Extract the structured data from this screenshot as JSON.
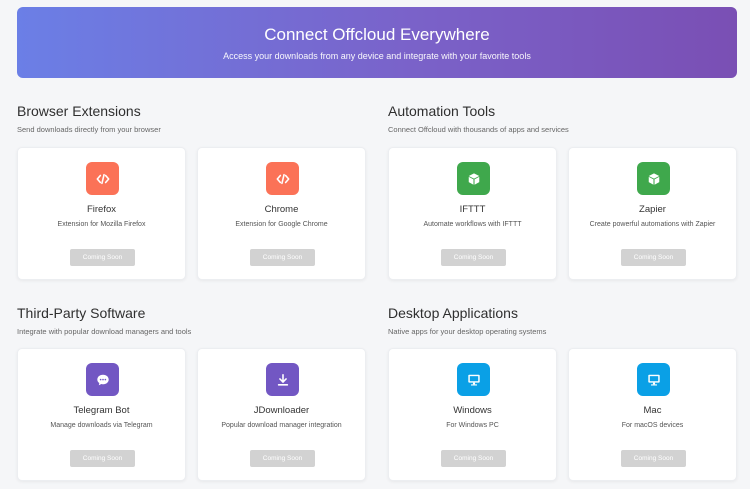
{
  "hero": {
    "title": "Connect Offcloud Everywhere",
    "subtitle": "Access your downloads from any device and integrate with your favorite tools"
  },
  "sections": [
    {
      "title": "Browser Extensions",
      "subtitle": "Send downloads directly from your browser",
      "cards": [
        {
          "title": "Firefox",
          "desc": "Extension for Mozilla Firefox",
          "button": "Coming Soon",
          "icon": "code-icon",
          "color": "#fb7257"
        },
        {
          "title": "Chrome",
          "desc": "Extension for Google Chrome",
          "button": "Coming Soon",
          "icon": "code-icon",
          "color": "#fb7257"
        }
      ]
    },
    {
      "title": "Automation Tools",
      "subtitle": "Connect Offcloud with thousands of apps and services",
      "cards": [
        {
          "title": "IFTTT",
          "desc": "Automate workflows with IFTTT",
          "button": "Coming Soon",
          "icon": "cube-icon",
          "color": "#3fa84c"
        },
        {
          "title": "Zapier",
          "desc": "Create powerful automations with Zapier",
          "button": "Coming Soon",
          "icon": "cube-icon",
          "color": "#3fa84c"
        }
      ]
    },
    {
      "title": "Third-Party Software",
      "subtitle": "Integrate with popular download managers and tools",
      "cards": [
        {
          "title": "Telegram Bot",
          "desc": "Manage downloads via Telegram",
          "button": "Coming Soon",
          "icon": "chat-bubble-icon",
          "color": "#7257c3"
        },
        {
          "title": "JDownloader",
          "desc": "Popular download manager integration",
          "button": "Coming Soon",
          "icon": "download-icon",
          "color": "#7257c3"
        }
      ]
    },
    {
      "title": "Desktop Applications",
      "subtitle": "Native apps for your desktop operating systems",
      "cards": [
        {
          "title": "Windows",
          "desc": "For Windows PC",
          "button": "Coming Soon",
          "icon": "monitor-icon",
          "color": "#0aa0e6"
        },
        {
          "title": "Mac",
          "desc": "For macOS devices",
          "button": "Coming Soon",
          "icon": "monitor-icon",
          "color": "#0aa0e6"
        }
      ]
    }
  ]
}
